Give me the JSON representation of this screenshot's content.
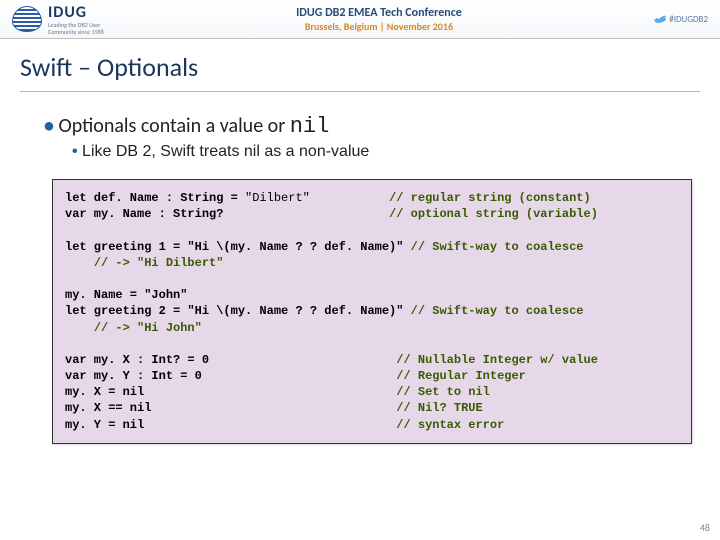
{
  "header": {
    "logo_text": "IDUG",
    "logo_tag1": "Leading the DB2 User",
    "logo_tag2": "Community since 1988",
    "conf_title": "IDUG DB2 EMEA Tech Conference",
    "conf_sub": "Brussels, Belgium | November 2016",
    "hashtag": "#IDUGDB2"
  },
  "title": "Swift – Optionals",
  "bullet_main_pre": "Optionals contain a value or ",
  "bullet_main_nil": "nil",
  "bullet_sub": "Like DB 2, Swift treats nil as a non-value",
  "code": {
    "l1a": "let def. Name : String = ",
    "l1b": "\"Dilbert\"",
    "l1s": "           ",
    "l1c": "// regular string (constant)",
    "l2a": "var my. Name : String?                       ",
    "l2c": "// optional string (variable)",
    "blank": " ",
    "l3a": "let greeting 1 = \"Hi \\(my. Name ? ? def. Name)\" ",
    "l3c": "// Swift-way to coalesce",
    "l4a": "    ",
    "l4c": "// -> \"Hi Dilbert\"",
    "l5a": "my. Name = \"John\"",
    "l6a": "let greeting 2 = \"Hi \\(my. Name ? ? def. Name)\" ",
    "l6c": "// Swift-way to coalesce",
    "l7a": "    ",
    "l7c": "// -> \"Hi John\"",
    "l8a": "var my. X : Int? = 0                          ",
    "l8c": "// Nullable Integer w/ value",
    "l9a": "var my. Y : Int = 0                           ",
    "l9c": "// Regular Integer",
    "l10a": "my. X = nil                                   ",
    "l10c": "// Set to nil",
    "l11a": "my. X == nil                                  ",
    "l11c": "// Nil? TRUE",
    "l12a": "my. Y = nil                                   ",
    "l12c": "// syntax error"
  },
  "page_number": "48"
}
